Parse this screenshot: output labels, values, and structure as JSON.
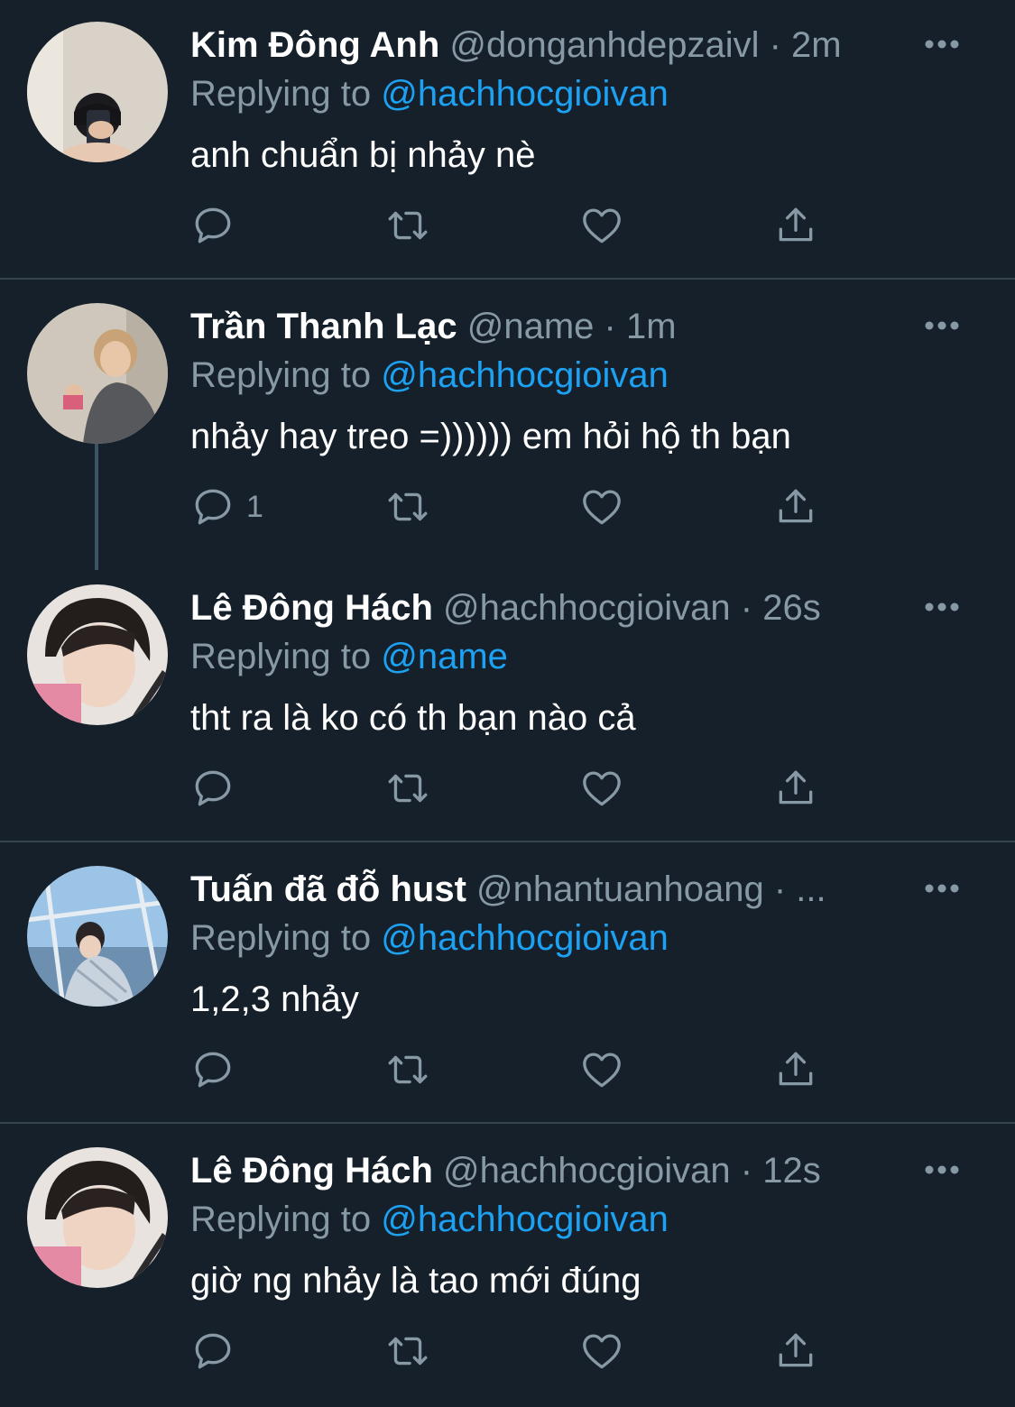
{
  "tweets": [
    {
      "name": "Kim Đông Anh",
      "handle": "@donganhdepzaivl",
      "sep": "·",
      "time": "2m",
      "replying_prefix": "Replying to",
      "replying_to": "@hachhocgioivan",
      "text": "anh chuẩn bị nhảy nè",
      "reply_count": ""
    },
    {
      "name": "Trần Thanh Lạc",
      "handle": "@name",
      "sep": "·",
      "time": "1m",
      "replying_prefix": "Replying to",
      "replying_to": "@hachhocgioivan",
      "text": "nhảy hay treo =)))))) em hỏi hộ th bạn",
      "reply_count": "1"
    },
    {
      "name": "Lê Đông Hách",
      "handle": "@hachhocgioivan",
      "sep": "·",
      "time": "26s",
      "replying_prefix": "Replying to",
      "replying_to": "@name",
      "text": "tht ra là ko có th bạn nào cả",
      "reply_count": ""
    },
    {
      "name": "Tuấn đã đỗ hust",
      "handle": "@nhantuanhoang",
      "sep": "·",
      "time": "...",
      "replying_prefix": "Replying to",
      "replying_to": "@hachhocgioivan",
      "text": "1,2,3 nhảy",
      "reply_count": ""
    },
    {
      "name": "Lê Đông Hách",
      "handle": "@hachhocgioivan",
      "sep": "·",
      "time": "12s",
      "replying_prefix": "Replying to",
      "replying_to": "@hachhocgioivan",
      "text": "giờ ng nhảy là tao mới đúng",
      "reply_count": ""
    }
  ],
  "icons": {
    "avatar": "avatar",
    "more": "more-horizontal-icon",
    "reply": "reply-icon",
    "retweet": "retweet-icon",
    "like": "heart-icon",
    "share": "share-icon"
  },
  "colors": {
    "background": "#15202b",
    "divider": "#38444d",
    "muted": "#8899a6",
    "link": "#1da1f2",
    "text": "#ffffff"
  }
}
